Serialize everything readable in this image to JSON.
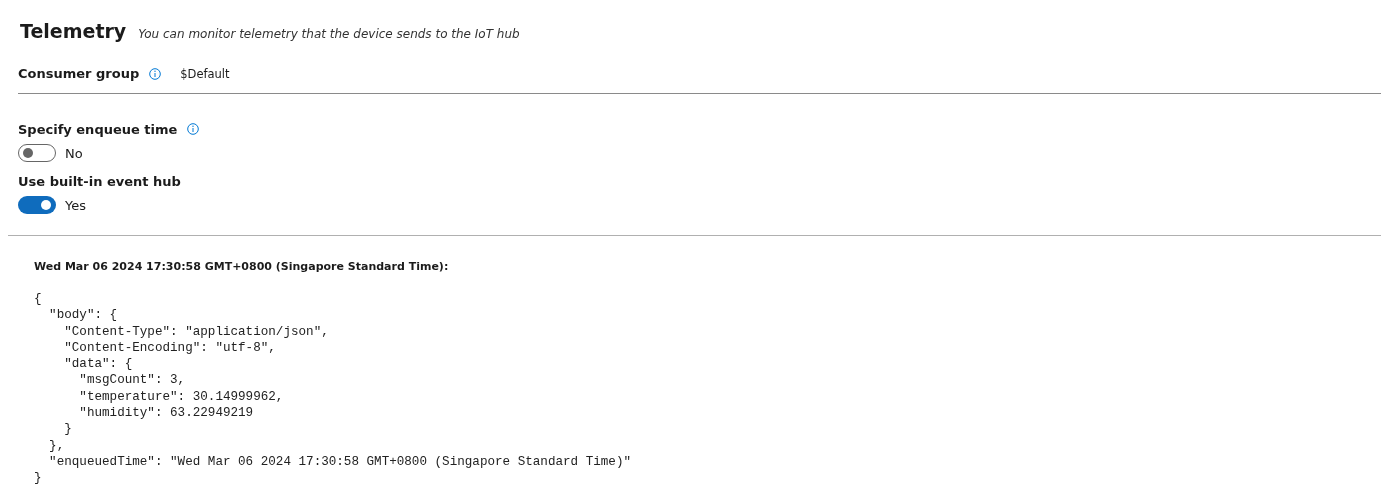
{
  "header": {
    "title": "Telemetry",
    "subtitle": "You can monitor telemetry that the device sends to the IoT hub"
  },
  "consumer_group": {
    "label": "Consumer group",
    "value": "$Default"
  },
  "toggles": [
    {
      "label": "Specify enqueue time",
      "info": true,
      "on": false,
      "state_text": "No"
    },
    {
      "label": "Use built-in event hub",
      "info": false,
      "on": true,
      "state_text": "Yes"
    }
  ],
  "message": {
    "timestamp": "Wed Mar 06 2024 17:30:58 GMT+0800 (Singapore Standard Time):",
    "code_lines": [
      "{",
      "  \"body\": {",
      "    \"Content-Type\": \"application/json\",",
      "    \"Content-Encoding\": \"utf-8\",",
      "    \"data\": {",
      "      \"msgCount\": 3,",
      "      \"temperature\": 30.14999962,",
      "      \"humidity\": 63.22949219",
      "    }",
      "  },",
      "  \"enqueuedTime\": \"Wed Mar 06 2024 17:30:58 GMT+0800 (Singapore Standard Time)\"",
      "}"
    ]
  }
}
